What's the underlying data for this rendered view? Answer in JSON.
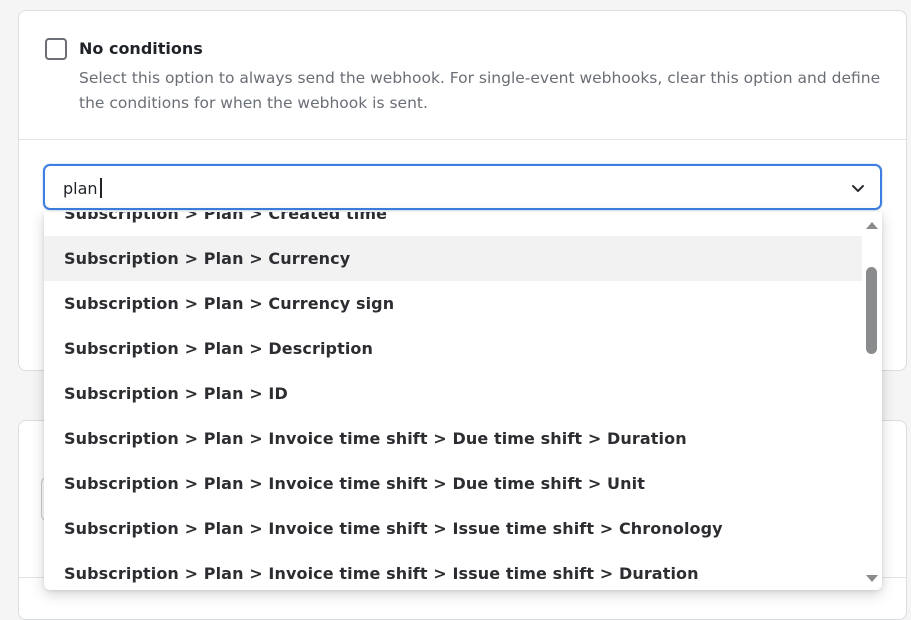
{
  "conditions": {
    "checkbox_label": "No conditions",
    "description": "Select this option to always send the webhook. For single-event webhooks, clear this option and define the conditions for when the webhook is sent.",
    "checked": false
  },
  "search": {
    "value": "plan",
    "dropdown_icon": "chevron-down-icon"
  },
  "dropdown": {
    "options": [
      "Subscription > Plan > Created time",
      "Subscription > Plan > Currency",
      "Subscription > Plan > Currency sign",
      "Subscription > Plan > Description",
      "Subscription > Plan > ID",
      "Subscription > Plan > Invoice time shift > Due time shift > Duration",
      "Subscription > Plan > Invoice time shift > Due time shift > Unit",
      "Subscription > Plan > Invoice time shift > Issue time shift > Chronology",
      "Subscription > Plan > Invoice time shift > Issue time shift > Duration"
    ],
    "highlighted_option": "Subscription > Plan > Currency"
  },
  "colors": {
    "focus_border": "#3d7ee0",
    "hover_bg": "#f2f2f3",
    "scrollbar_thumb": "#8a8b8d"
  }
}
